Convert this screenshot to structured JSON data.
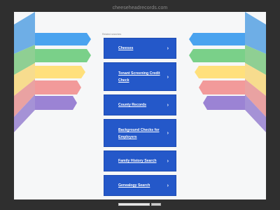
{
  "domain": "cheeseheadrecords.com",
  "related_label": "Related searches",
  "links": [
    {
      "label": "Cheeses"
    },
    {
      "label": "Tenant Screening Credit Check"
    },
    {
      "label": "County Records"
    },
    {
      "label": "Background Checks for Employers"
    },
    {
      "label": "Family History Search"
    },
    {
      "label": "Genealogy Search"
    }
  ],
  "chevron": "›",
  "colors": {
    "background": "#2f2f2f",
    "panel": "#f6f7f8",
    "link_bg": "#2458c9",
    "ribbon_blue": "#5ab0f0",
    "ribbon_green": "#7ed08c",
    "ribbon_yellow": "#ffe08a",
    "ribbon_red": "#f0a0a0",
    "ribbon_purple": "#a08ed6"
  }
}
